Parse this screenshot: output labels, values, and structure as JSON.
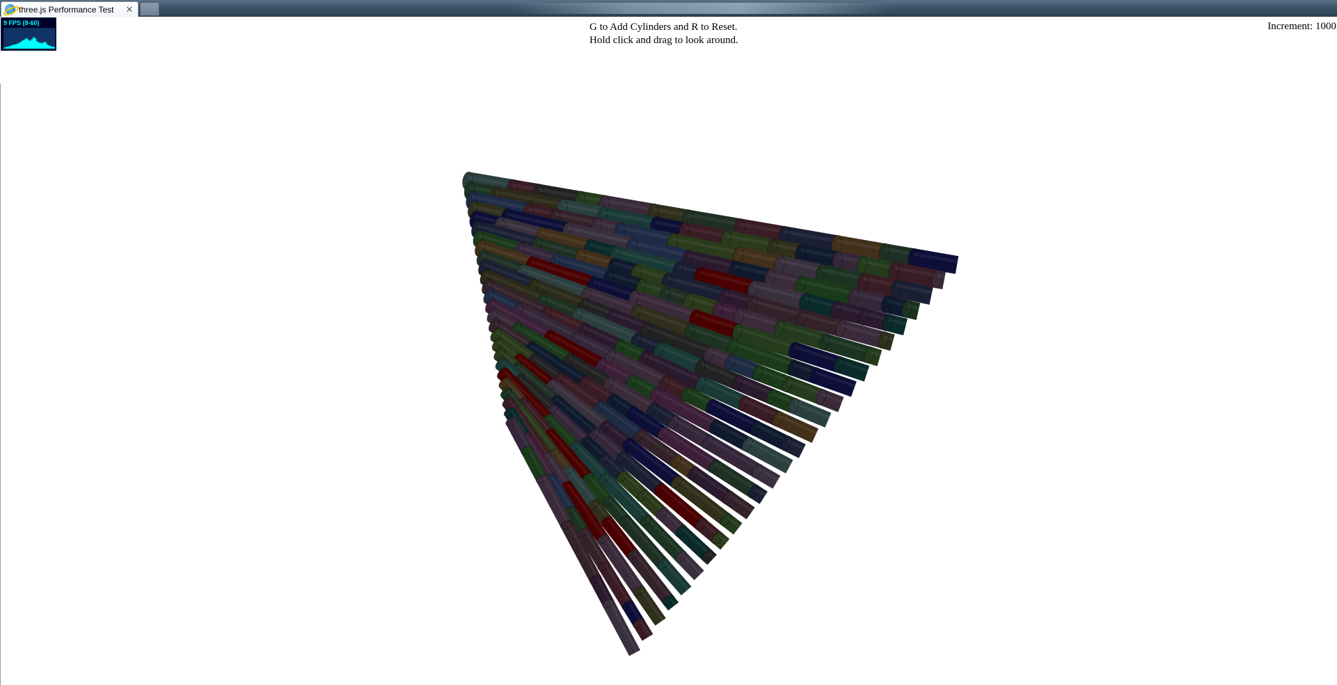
{
  "browser": {
    "tab_title": "three.js Performance Test",
    "close_symbol": "✕"
  },
  "stats": {
    "fps_label": "9 FPS (8-60)",
    "fps": 9,
    "fps_min": 8,
    "fps_max": 60,
    "history": [
      0.05,
      0.08,
      0.1,
      0.12,
      0.15,
      0.18,
      0.2,
      0.22,
      0.25,
      0.3,
      0.35,
      0.4,
      0.45,
      0.5,
      0.42,
      0.38,
      0.45,
      0.55,
      0.5,
      0.35,
      0.3,
      0.28,
      0.25,
      0.32,
      0.3,
      0.2,
      0.15,
      0.12,
      0.1,
      0.08
    ]
  },
  "instructions": {
    "line1": "G to Add Cylinders and R to Reset.",
    "line2": "Hold click and drag to look around."
  },
  "increment": {
    "text": "Increment: 1000"
  },
  "scene": {
    "object": "cylinders",
    "palette": [
      "#2b1a2e",
      "#1f2f24",
      "#33222a",
      "#1a1f33",
      "#2c2a18",
      "#3a1c24",
      "#193a36",
      "#2a3a1a",
      "#0f1a2e",
      "#3a2a3a",
      "#1c3322",
      "#42301a",
      "#222222",
      "#2b3f3f",
      "#3d1f3a",
      "#1e2b45",
      "#4a0000",
      "#1a3a1a",
      "#2f2f1c",
      "#0b2a2a",
      "#39303d",
      "#243b1c",
      "#35263a",
      "#0e0f38"
    ]
  }
}
